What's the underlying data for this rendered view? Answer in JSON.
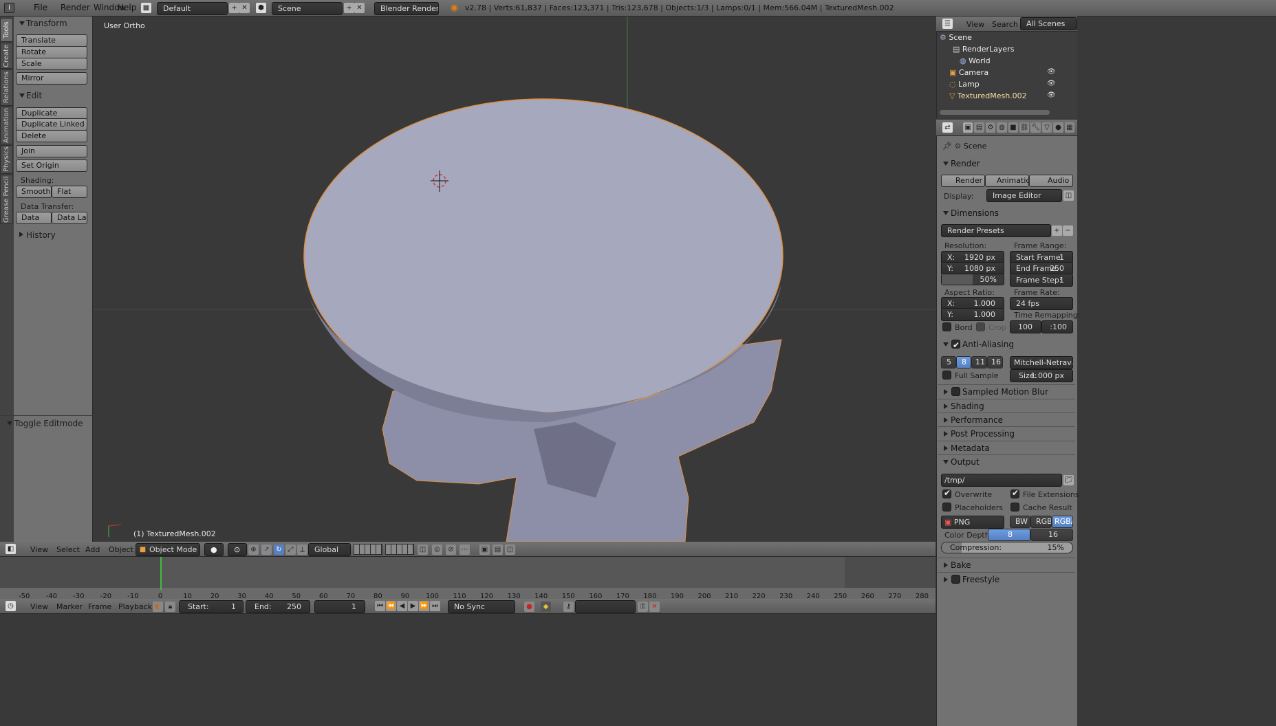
{
  "topbar": {
    "menus": [
      "File",
      "Render",
      "Window",
      "Help"
    ],
    "layout": "Default",
    "scene": "Scene",
    "engine": "Blender Render",
    "stats": "v2.78 | Verts:61,837 | Faces:123,371 | Tris:123,678 | Objects:1/3 | Lamps:0/1 | Mem:566.04M | TexturedMesh.002"
  },
  "tabs": [
    "Tools",
    "Create",
    "Relations",
    "Animation",
    "Physics",
    "Grease Pencil"
  ],
  "toolshelf": {
    "transform": "Transform",
    "translate": "Translate",
    "rotate": "Rotate",
    "scale": "Scale",
    "mirror": "Mirror",
    "edit": "Edit",
    "duplicate": "Duplicate",
    "duplicate_linked": "Duplicate Linked",
    "delete": "Delete",
    "join": "Join",
    "set_origin": "Set Origin",
    "shading": "Shading:",
    "smooth": "Smooth",
    "flat": "Flat",
    "data_transfer": "Data Transfer:",
    "data": "Data",
    "data_layo": "Data Layo",
    "history": "History",
    "toggle_editmode": "Toggle Editmode"
  },
  "viewport": {
    "view_label": "User Ortho",
    "object_label": "(1) TexturedMesh.002",
    "menus": [
      "View",
      "Select",
      "Add",
      "Object"
    ],
    "mode": "Object Mode",
    "orientation": "Global"
  },
  "outliner": {
    "menus": [
      "View",
      "Search"
    ],
    "filter": "All Scenes",
    "items": [
      "Scene",
      "RenderLayers",
      "World",
      "Camera",
      "Lamp",
      "TexturedMesh.002"
    ]
  },
  "properties": {
    "context": "Scene",
    "render": "Render",
    "render_btn": "Render",
    "animation_btn": "Animation",
    "audio_btn": "Audio",
    "display_label": "Display:",
    "display_value": "Image Editor",
    "dimensions": "Dimensions",
    "presets": "Render Presets",
    "resolution": "Resolution:",
    "res_x": "X:",
    "res_x_val": "1920 px",
    "res_y": "Y:",
    "res_y_val": "1080 px",
    "res_pct": "50%",
    "frame_range": "Frame Range:",
    "start_frame": "Start Frame:",
    "start_val": "1",
    "end_frame": "End Frame:",
    "end_val": "250",
    "frame_step": "Frame Step:",
    "step_val": "1",
    "aspect": "Aspect Ratio:",
    "asp_x": "X:",
    "asp_x_val": "1.000",
    "asp_y": "Y:",
    "asp_y_val": "1.000",
    "frame_rate": "Frame Rate:",
    "fps": "24 fps",
    "time_remap": "Time Remapping:",
    "remap_old": "100",
    "remap_new": ":100",
    "bord": "Bord",
    "crop": "Crop",
    "anti_aliasing": "Anti-Aliasing",
    "aa": [
      "5",
      "8",
      "11",
      "16"
    ],
    "filter": "Mitchell-Netravali",
    "full_sample": "Full Sample",
    "size_label": "Size:",
    "size_val": "1.000 px",
    "motion_blur": "Sampled Motion Blur",
    "shading": "Shading",
    "performance": "Performance",
    "post_processing": "Post Processing",
    "metadata": "Metadata",
    "output": "Output",
    "path": "/tmp/",
    "overwrite": "Overwrite",
    "file_ext": "File Extensions",
    "placeholders": "Placeholders",
    "cache_result": "Cache Result",
    "format": "PNG",
    "bw": "BW",
    "rgb": "RGB",
    "rgba": "RGBA",
    "color_depth": "Color Depth:",
    "depth8": "8",
    "depth16": "16",
    "compression": "Compression:",
    "compression_val": "15%",
    "bake": "Bake",
    "freestyle": "Freestyle"
  },
  "timeline": {
    "ticks": [
      "-50",
      "-40",
      "-30",
      "-20",
      "-10",
      "0",
      "10",
      "20",
      "30",
      "40",
      "50",
      "60",
      "70",
      "80",
      "90",
      "100",
      "110",
      "120",
      "130",
      "140",
      "150",
      "160",
      "170",
      "180",
      "190",
      "200",
      "210",
      "220",
      "230",
      "240",
      "250",
      "260",
      "270",
      "280"
    ],
    "menus": [
      "View",
      "Marker",
      "Frame",
      "Playback"
    ],
    "start_label": "Start:",
    "start": "1",
    "end_label": "End:",
    "end": "250",
    "current": "1",
    "sync": "No Sync",
    "current_frame": 0
  }
}
